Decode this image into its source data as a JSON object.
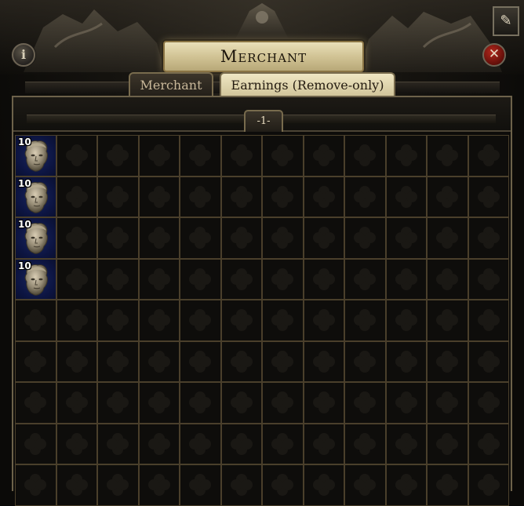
{
  "window": {
    "title": "Merchant",
    "info_icon": "info-icon",
    "close_icon": "close-icon",
    "note_icon": "quill-note-icon"
  },
  "tabs": [
    {
      "label": "Merchant",
      "active": false
    },
    {
      "label": "Earnings (Remove-only)",
      "active": true
    }
  ],
  "page_tab": {
    "label": "-1-"
  },
  "grid": {
    "columns": 12,
    "rows_visible": 9,
    "items": [
      {
        "row": 0,
        "col": 0,
        "stack": "10",
        "icon": "divine-orb-face-icon"
      },
      {
        "row": 1,
        "col": 0,
        "stack": "10",
        "icon": "divine-orb-face-icon"
      },
      {
        "row": 2,
        "col": 0,
        "stack": "10",
        "icon": "divine-orb-face-icon"
      },
      {
        "row": 3,
        "col": 0,
        "stack": "10",
        "icon": "divine-orb-face-icon"
      }
    ]
  },
  "colors": {
    "title_plaque": "#d8cba0",
    "active_tab": "#e6dcb6",
    "cell_border": "#4a3f2b",
    "item_bg": "#101a4a",
    "close_red": "#9c1e15"
  }
}
